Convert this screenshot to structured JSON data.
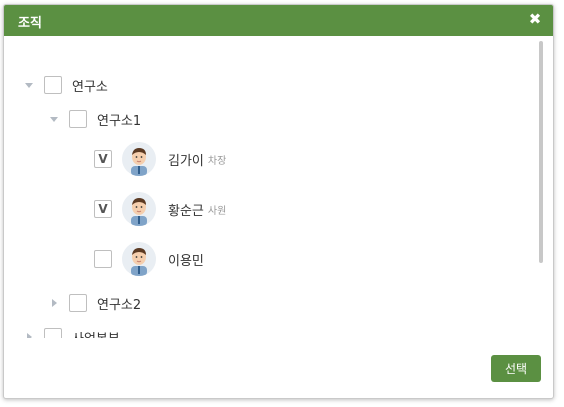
{
  "dialog": {
    "title": "조직",
    "close_icon": "close-icon",
    "select_label": "선택",
    "accent_color": "#5b9042"
  },
  "tree": [
    {
      "type": "group",
      "label": "연구소",
      "expanded": true,
      "checked": false
    },
    {
      "type": "group",
      "label": "연구소1",
      "expanded": true,
      "checked": false
    },
    {
      "type": "person",
      "name": "김가이",
      "title": "차장",
      "checked": true,
      "check_mark": "V"
    },
    {
      "type": "person",
      "name": "황순근",
      "title": "사원",
      "checked": true,
      "check_mark": "V"
    },
    {
      "type": "person",
      "name": "이용민",
      "title": "",
      "checked": false,
      "check_mark": ""
    },
    {
      "type": "group",
      "label": "연구소2",
      "expanded": false,
      "checked": false
    },
    {
      "type": "group",
      "label": "사업본부",
      "expanded": false,
      "checked": false
    }
  ]
}
